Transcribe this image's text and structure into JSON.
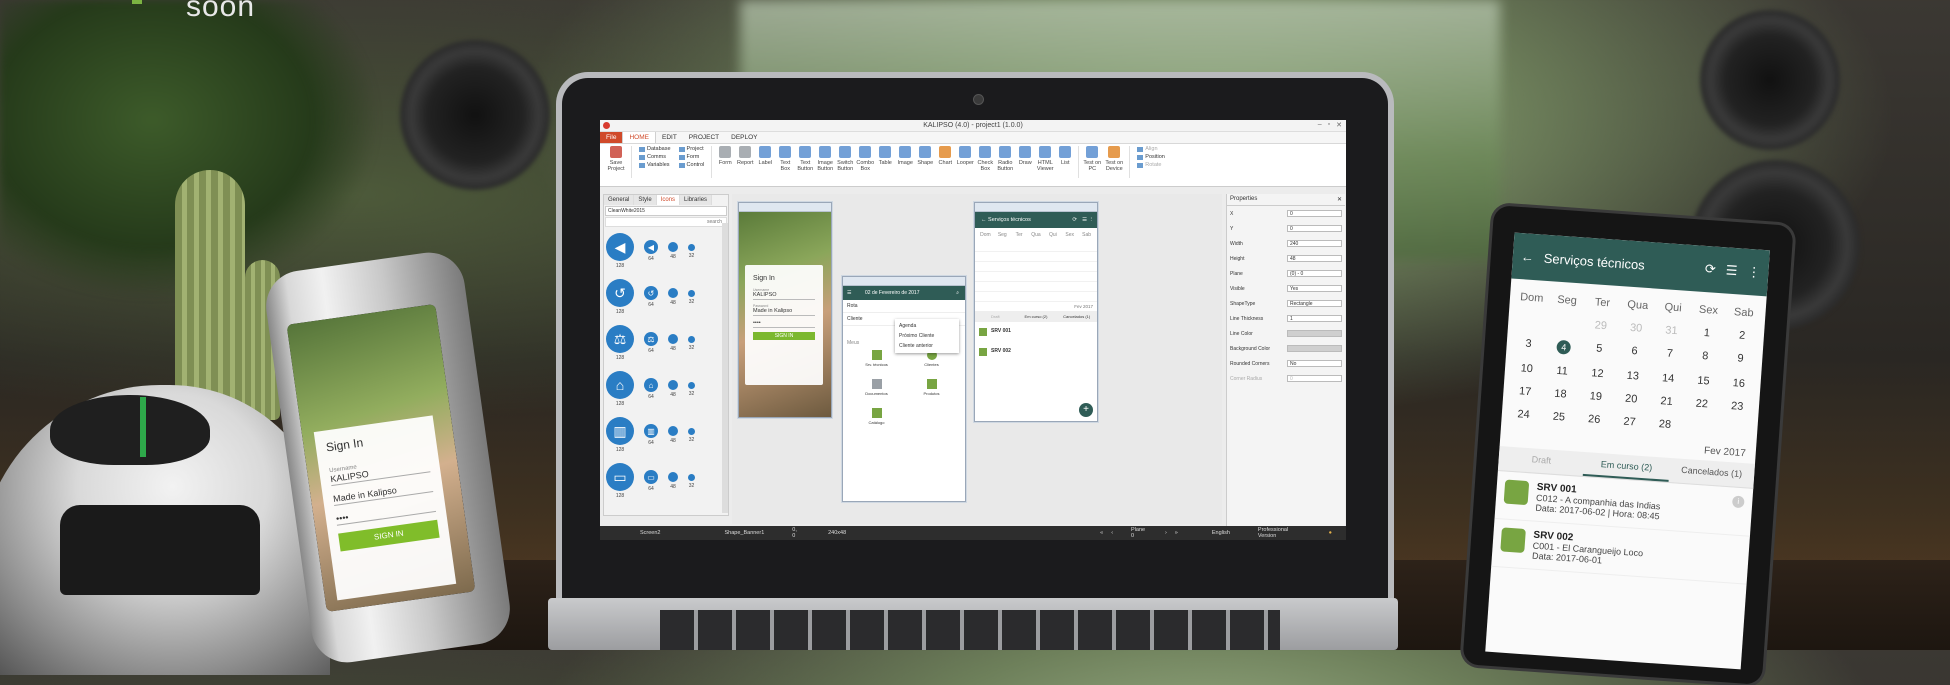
{
  "brand": {
    "tagline": "soon"
  },
  "app": {
    "title": "KALIPSO (4.0) - project1 (1.0.0)",
    "menu": [
      "File",
      "HOME",
      "EDIT",
      "PROJECT",
      "DEPLOY"
    ],
    "ribbon": {
      "save": "Save Project",
      "group_db": [
        "Database",
        "Comms",
        "Variables"
      ],
      "group_proj": [
        "Project",
        "Form",
        "Control"
      ],
      "tools": [
        "Form",
        "Report",
        "Label",
        "Text Box",
        "Text Button",
        "Image Button",
        "Switch Button",
        "Combo Box",
        "Table",
        "Image",
        "Shape",
        "Chart",
        "Looper",
        "Check Box",
        "Radio Button",
        "Draw",
        "HTML Viewer",
        "List",
        "Test on PC",
        "Test on Device"
      ],
      "align_group": [
        "Align",
        "Position",
        "Rotate"
      ]
    },
    "left_panel": {
      "tabs": [
        "General",
        "Style",
        "Icons",
        "Libraries"
      ],
      "set_name": "CleanWhite2015",
      "search": "search",
      "sizes": [
        "128",
        "64",
        "48",
        "32"
      ]
    },
    "canvas": {
      "signin": {
        "title": "Sign In",
        "user_label": "Username",
        "user": "KALIPSO",
        "pass_label": "Password",
        "company": "Made in Kalipso",
        "password": "••••",
        "button": "SIGN IN"
      },
      "agenda": {
        "date": "02 de Fevereiro de 2017",
        "menu": [
          "Agenda",
          "Próximo Cliente",
          "Cliente anterior"
        ],
        "row1": "Rota",
        "row2": "Cliente",
        "section": "Meus",
        "tiles": [
          "Srv. técnicos",
          "Clientes",
          "Documentos",
          "Produtos",
          "Catálogo"
        ]
      },
      "services": {
        "title": "Serviços técnicos",
        "days": [
          "Dom",
          "Seg",
          "Ter",
          "Qua",
          "Qui",
          "Sex",
          "Sab"
        ],
        "month": "Fev 2017",
        "tabs": [
          "Draft",
          "Em curso (2)",
          "Cancelados (1)"
        ],
        "items": [
          "SRV 001",
          "SRV 002"
        ]
      }
    },
    "properties": {
      "title": "Properties",
      "rows": [
        {
          "k": "X",
          "v": "0"
        },
        {
          "k": "Y",
          "v": "0"
        },
        {
          "k": "Width",
          "v": "240"
        },
        {
          "k": "Height",
          "v": "48"
        },
        {
          "k": "Plane",
          "v": "(0) - 0"
        },
        {
          "k": "Visible",
          "v": "Yes"
        },
        {
          "k": "ShapeType",
          "v": "Rectangle"
        },
        {
          "k": "Line Thickness",
          "v": "1"
        },
        {
          "k": "Line Color",
          "v": ""
        },
        {
          "k": "Background Color",
          "v": ""
        },
        {
          "k": "Rounded Corners",
          "v": "No"
        },
        {
          "k": "Corner Radius",
          "v": "0"
        }
      ]
    },
    "status": {
      "screen": "Screen2",
      "shape": "Shape_Banner1",
      "coords": "0, 0",
      "size": "240x48",
      "plane": "Plane 0",
      "lang": "English",
      "edition": "Professional Version"
    }
  },
  "phone": {
    "title": "Sign In",
    "user_label": "Username",
    "user": "KALIPSO",
    "company": "Made in Kalipso",
    "password": "••••",
    "button": "SIGN IN"
  },
  "tablet": {
    "title": "Serviços técnicos",
    "days": [
      "Dom",
      "Seg",
      "Ter",
      "Qua",
      "Qui",
      "Sex",
      "Sab"
    ],
    "weeks": [
      [
        "29",
        "30",
        "31",
        "1",
        "2"
      ],
      [
        "3",
        "4",
        "5",
        "6",
        "7",
        "8",
        "9"
      ],
      [
        "10",
        "11",
        "12",
        "13",
        "14",
        "15",
        "16"
      ],
      [
        "17",
        "18",
        "19",
        "20",
        "21",
        "22",
        "23"
      ],
      [
        "24",
        "25",
        "26",
        "27",
        "28"
      ]
    ],
    "month": "Fev 2017",
    "tabs": [
      "Draft",
      "Em curso (2)",
      "Cancelados (1)"
    ],
    "items": [
      {
        "code": "SRV 001",
        "desc": "C012 - A companhia das Indias",
        "date": "Data: 2017-06-02 | Hora: 08:45"
      },
      {
        "code": "SRV 002",
        "desc": "C001 - El Carangueijo Loco",
        "date": "Data: 2017-06-01"
      }
    ]
  }
}
